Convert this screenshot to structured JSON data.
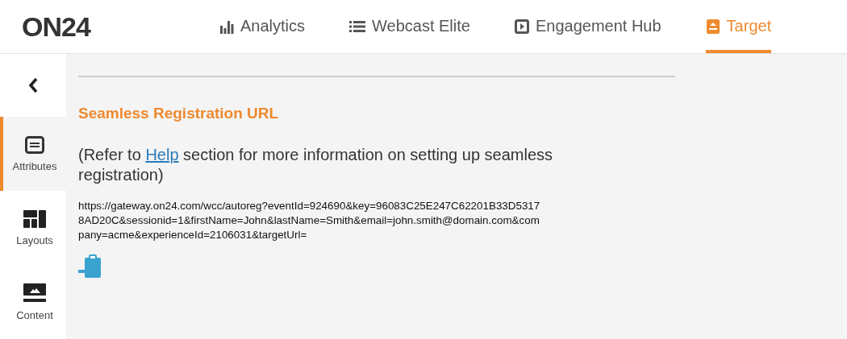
{
  "header": {
    "logo": "ON24",
    "tabs": [
      {
        "label": "Analytics",
        "kind": "bars",
        "selected": false
      },
      {
        "label": "Webcast Elite",
        "kind": "list",
        "selected": false
      },
      {
        "label": "Engagement Hub",
        "kind": "play",
        "selected": false
      },
      {
        "label": "Target",
        "kind": "target",
        "selected": true
      }
    ]
  },
  "sidebar": {
    "items": [
      {
        "label": "Attributes",
        "kind": "attributes",
        "selected": true
      },
      {
        "label": "Layouts",
        "kind": "layouts",
        "selected": false
      },
      {
        "label": "Content",
        "kind": "content",
        "selected": false
      }
    ]
  },
  "section": {
    "title": "Seamless Registration URL",
    "note_before": "(Refer to",
    "note_link": "Help",
    "note_after": "section for more information on setting up seamless registration)",
    "url_lines": [
      "https://gateway.on24.com/wcc/autoreg?eventId=924690&key=96083C25E247C62201B33D5317",
      "8AD20C&sessionid=1&firstName=John&lastName=Smith&email=john.smith@domain.com&com",
      "pany=acme&experienceId=2106031&targetUrl="
    ]
  }
}
